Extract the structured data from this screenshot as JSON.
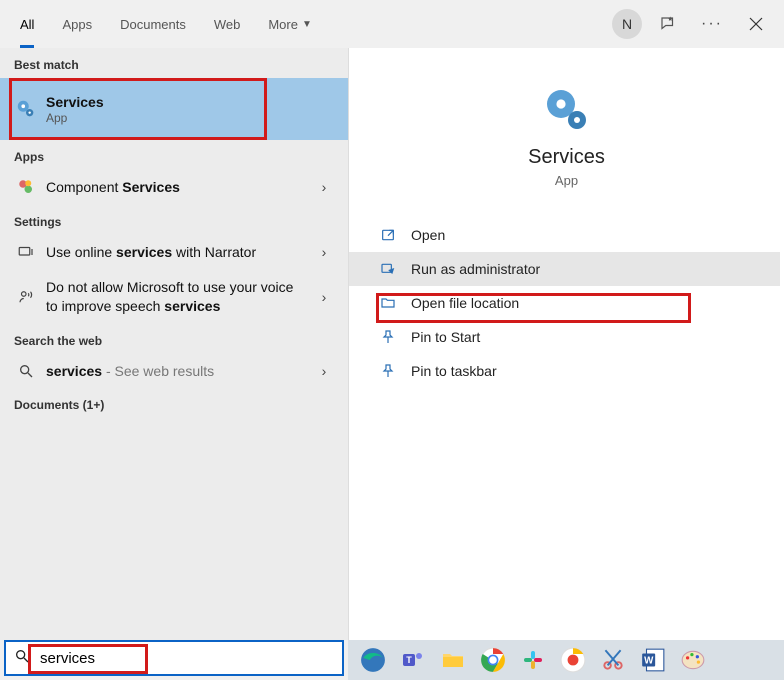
{
  "tabs": {
    "all": "All",
    "apps": "Apps",
    "documents": "Documents",
    "web": "Web",
    "more": "More"
  },
  "avatar_initial": "N",
  "left": {
    "best_match_label": "Best match",
    "best_match": {
      "title": "Services",
      "subtitle": "App"
    },
    "apps_label": "Apps",
    "apps_item": {
      "prefix": "Component ",
      "bold": "Services"
    },
    "settings_label": "Settings",
    "setting1": {
      "p1": "Use online ",
      "b": "services",
      "p2": " with Narrator"
    },
    "setting2": {
      "p1": "Do not allow Microsoft to use your voice to improve speech ",
      "b": "services"
    },
    "search_web_label": "Search the web",
    "web_item": {
      "b": "services",
      "tail": " - See web results"
    },
    "documents_label": "Documents (1+)"
  },
  "preview": {
    "title": "Services",
    "subtitle": "App",
    "actions": {
      "open": "Open",
      "run_admin": "Run as administrator",
      "open_loc": "Open file location",
      "pin_start": "Pin to Start",
      "pin_taskbar": "Pin to taskbar"
    }
  },
  "search": {
    "value": "services"
  }
}
